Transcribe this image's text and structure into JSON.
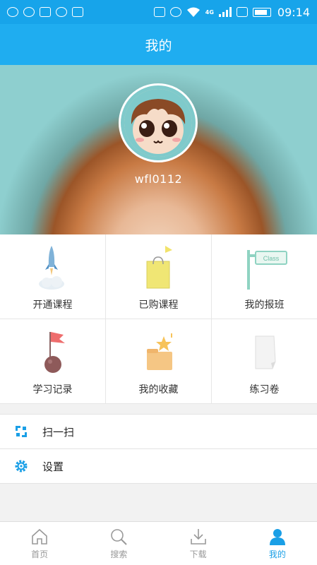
{
  "status_bar": {
    "network": "4G",
    "time": "09:14"
  },
  "header": {
    "title": "我的"
  },
  "profile": {
    "username": "wfl0112"
  },
  "grid": {
    "items": [
      {
        "label": "开通课程",
        "icon": "rocket-icon"
      },
      {
        "label": "已购课程",
        "icon": "shopping-bag-icon"
      },
      {
        "label": "我的报班",
        "icon": "class-signpost-icon",
        "sign_text": "Class"
      },
      {
        "label": "学习记录",
        "icon": "flag-icon"
      },
      {
        "label": "我的收藏",
        "icon": "folder-star-icon"
      },
      {
        "label": "练习卷",
        "icon": "paper-icon"
      }
    ]
  },
  "list": {
    "items": [
      {
        "label": "扫一扫",
        "icon": "scan-icon"
      },
      {
        "label": "设置",
        "icon": "gear-icon"
      }
    ]
  },
  "bottom_nav": {
    "active": "我的",
    "tabs": [
      {
        "label": "首页",
        "icon": "home-icon"
      },
      {
        "label": "搜索",
        "icon": "search-icon"
      },
      {
        "label": "下载",
        "icon": "download-icon"
      },
      {
        "label": "我的",
        "icon": "user-icon"
      }
    ]
  },
  "colors": {
    "primary": "#1fadf0",
    "active_tab": "#1a9fe6",
    "inactive_tab": "#999999"
  }
}
